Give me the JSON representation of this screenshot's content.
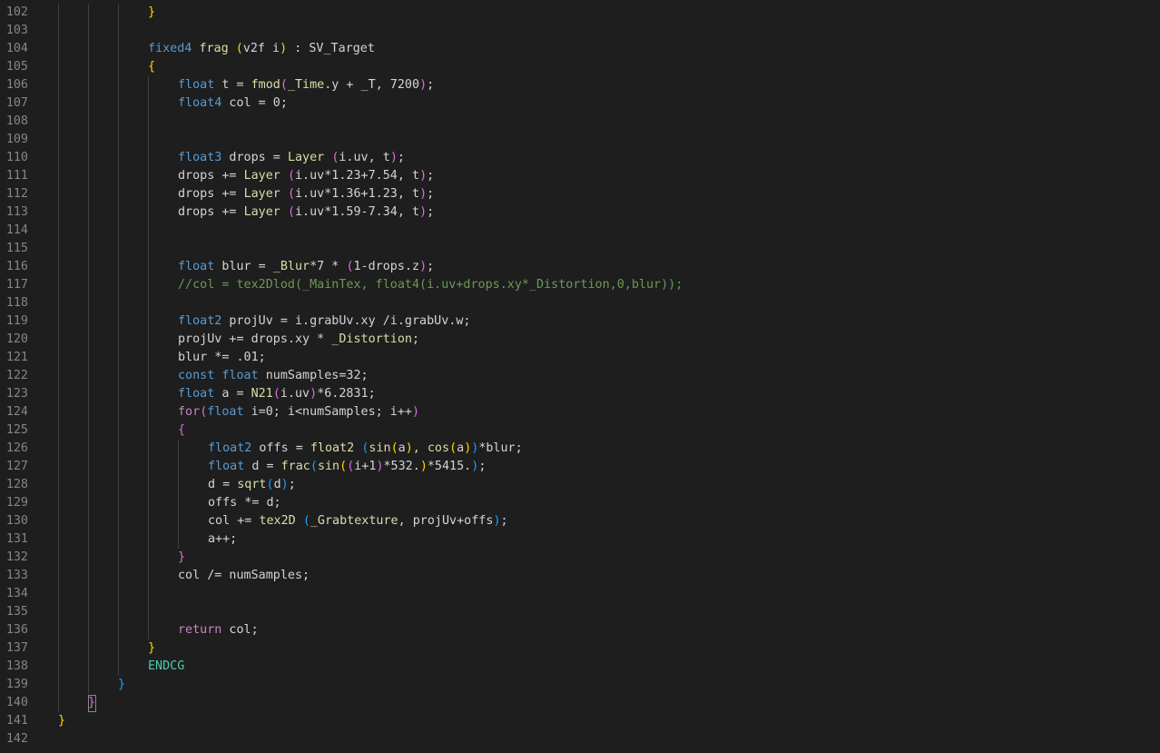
{
  "editor": {
    "language": "HLSL",
    "colors": {
      "background": "#1e1e1e",
      "line_number": "#858585",
      "keyword": "#569cd6",
      "type": "#4ec9b0",
      "function": "#dcdcaa",
      "variable": "#9cdcfe",
      "number": "#b5cea8",
      "comment": "#6a9955",
      "control": "#c586c0",
      "bracket_1": "#ffd700",
      "bracket_2": "#da70d6",
      "bracket_3": "#179fff",
      "text": "#d4d4d4"
    },
    "lines": [
      {
        "number": "102",
        "indent": 3,
        "tokens": [
          {
            "t": "}",
            "c": "b1"
          }
        ]
      },
      {
        "number": "103",
        "indent": 3,
        "tokens": []
      },
      {
        "number": "104",
        "indent": 3,
        "tokens": [
          {
            "t": "fixed4",
            "c": "kw"
          },
          {
            "t": " ",
            "c": "txt"
          },
          {
            "t": "frag",
            "c": "fn"
          },
          {
            "t": " ",
            "c": "txt"
          },
          {
            "t": "(",
            "c": "b1"
          },
          {
            "t": "v2f i",
            "c": "txt"
          },
          {
            "t": ")",
            "c": "b1"
          },
          {
            "t": " : SV_Target",
            "c": "txt"
          }
        ]
      },
      {
        "number": "105",
        "indent": 3,
        "tokens": [
          {
            "t": "{",
            "c": "b1"
          }
        ]
      },
      {
        "number": "106",
        "indent": 4,
        "tokens": [
          {
            "t": "float",
            "c": "kw"
          },
          {
            "t": " t = ",
            "c": "txt"
          },
          {
            "t": "fmod",
            "c": "fn"
          },
          {
            "t": "(",
            "c": "b2"
          },
          {
            "t": "_Time",
            "c": "fn"
          },
          {
            "t": ".y + ",
            "c": "txt"
          },
          {
            "t": "_T",
            "c": "fn"
          },
          {
            "t": ", 7200",
            "c": "txt"
          },
          {
            "t": ")",
            "c": "b2"
          },
          {
            "t": ";",
            "c": "txt"
          }
        ]
      },
      {
        "number": "107",
        "indent": 4,
        "tokens": [
          {
            "t": "float4",
            "c": "kw"
          },
          {
            "t": " col = 0;",
            "c": "txt"
          }
        ]
      },
      {
        "number": "108",
        "indent": 4,
        "tokens": []
      },
      {
        "number": "109",
        "indent": 4,
        "tokens": []
      },
      {
        "number": "110",
        "indent": 4,
        "tokens": [
          {
            "t": "float3",
            "c": "kw"
          },
          {
            "t": " drops = ",
            "c": "txt"
          },
          {
            "t": "Layer",
            "c": "fn"
          },
          {
            "t": " ",
            "c": "txt"
          },
          {
            "t": "(",
            "c": "b2"
          },
          {
            "t": "i.uv, t",
            "c": "txt"
          },
          {
            "t": ")",
            "c": "b2"
          },
          {
            "t": ";",
            "c": "txt"
          }
        ]
      },
      {
        "number": "111",
        "indent": 4,
        "tokens": [
          {
            "t": "drops += ",
            "c": "txt"
          },
          {
            "t": "Layer",
            "c": "fn"
          },
          {
            "t": " ",
            "c": "txt"
          },
          {
            "t": "(",
            "c": "b2"
          },
          {
            "t": "i.uv*1.23+7.54, t",
            "c": "txt"
          },
          {
            "t": ")",
            "c": "b2"
          },
          {
            "t": ";",
            "c": "txt"
          }
        ]
      },
      {
        "number": "112",
        "indent": 4,
        "tokens": [
          {
            "t": "drops += ",
            "c": "txt"
          },
          {
            "t": "Layer",
            "c": "fn"
          },
          {
            "t": " ",
            "c": "txt"
          },
          {
            "t": "(",
            "c": "b2"
          },
          {
            "t": "i.uv*1.36+1.23, t",
            "c": "txt"
          },
          {
            "t": ")",
            "c": "b2"
          },
          {
            "t": ";",
            "c": "txt"
          }
        ]
      },
      {
        "number": "113",
        "indent": 4,
        "tokens": [
          {
            "t": "drops += ",
            "c": "txt"
          },
          {
            "t": "Layer",
            "c": "fn"
          },
          {
            "t": " ",
            "c": "txt"
          },
          {
            "t": "(",
            "c": "b2"
          },
          {
            "t": "i.uv*1.59-7.34, t",
            "c": "txt"
          },
          {
            "t": ")",
            "c": "b2"
          },
          {
            "t": ";",
            "c": "txt"
          }
        ]
      },
      {
        "number": "114",
        "indent": 4,
        "tokens": []
      },
      {
        "number": "115",
        "indent": 4,
        "tokens": []
      },
      {
        "number": "116",
        "indent": 4,
        "tokens": [
          {
            "t": "float",
            "c": "kw"
          },
          {
            "t": " blur = ",
            "c": "txt"
          },
          {
            "t": "_Blur",
            "c": "fn"
          },
          {
            "t": "*7 * ",
            "c": "txt"
          },
          {
            "t": "(",
            "c": "b2"
          },
          {
            "t": "1-drops.z",
            "c": "txt"
          },
          {
            "t": ")",
            "c": "b2"
          },
          {
            "t": ";",
            "c": "txt"
          }
        ]
      },
      {
        "number": "117",
        "indent": 4,
        "tokens": [
          {
            "t": "//col = tex2Dlod(_MainTex, float4(i.uv+drops.xy*_Distortion,0,blur));",
            "c": "cm"
          }
        ]
      },
      {
        "number": "118",
        "indent": 4,
        "tokens": []
      },
      {
        "number": "119",
        "indent": 4,
        "tokens": [
          {
            "t": "float2",
            "c": "kw"
          },
          {
            "t": " projUv = i.grabUv.xy /i.grabUv.w;",
            "c": "txt"
          }
        ]
      },
      {
        "number": "120",
        "indent": 4,
        "tokens": [
          {
            "t": "projUv += drops.xy * ",
            "c": "txt"
          },
          {
            "t": "_Distortion",
            "c": "fn"
          },
          {
            "t": ";",
            "c": "txt"
          }
        ]
      },
      {
        "number": "121",
        "indent": 4,
        "tokens": [
          {
            "t": "blur *= .01;",
            "c": "txt"
          }
        ]
      },
      {
        "number": "122",
        "indent": 4,
        "tokens": [
          {
            "t": "const",
            "c": "kw"
          },
          {
            "t": " ",
            "c": "txt"
          },
          {
            "t": "float",
            "c": "kw"
          },
          {
            "t": " numSamples=32;",
            "c": "txt"
          }
        ]
      },
      {
        "number": "123",
        "indent": 4,
        "tokens": [
          {
            "t": "float",
            "c": "kw"
          },
          {
            "t": " a = ",
            "c": "txt"
          },
          {
            "t": "N21",
            "c": "fn"
          },
          {
            "t": "(",
            "c": "b2"
          },
          {
            "t": "i.uv",
            "c": "txt"
          },
          {
            "t": ")",
            "c": "b2"
          },
          {
            "t": "*6.2831;",
            "c": "txt"
          }
        ]
      },
      {
        "number": "124",
        "indent": 4,
        "tokens": [
          {
            "t": "for",
            "c": "ctl"
          },
          {
            "t": "(",
            "c": "b2"
          },
          {
            "t": "float",
            "c": "kw"
          },
          {
            "t": " i=0; i<numSamples; i++",
            "c": "txt"
          },
          {
            "t": ")",
            "c": "b2"
          }
        ]
      },
      {
        "number": "125",
        "indent": 4,
        "tokens": [
          {
            "t": "{",
            "c": "b2"
          }
        ]
      },
      {
        "number": "126",
        "indent": 5,
        "tokens": [
          {
            "t": "float2",
            "c": "kw"
          },
          {
            "t": " offs = ",
            "c": "txt"
          },
          {
            "t": "float2",
            "c": "fn"
          },
          {
            "t": " ",
            "c": "txt"
          },
          {
            "t": "(",
            "c": "b3"
          },
          {
            "t": "sin",
            "c": "fn"
          },
          {
            "t": "(",
            "c": "b1"
          },
          {
            "t": "a",
            "c": "txt"
          },
          {
            "t": ")",
            "c": "b1"
          },
          {
            "t": ", ",
            "c": "txt"
          },
          {
            "t": "cos",
            "c": "fn"
          },
          {
            "t": "(",
            "c": "b1"
          },
          {
            "t": "a",
            "c": "txt"
          },
          {
            "t": ")",
            "c": "b1"
          },
          {
            "t": ")",
            "c": "b3"
          },
          {
            "t": "*blur;",
            "c": "txt"
          }
        ]
      },
      {
        "number": "127",
        "indent": 5,
        "tokens": [
          {
            "t": "float",
            "c": "kw"
          },
          {
            "t": " d = ",
            "c": "txt"
          },
          {
            "t": "frac",
            "c": "fn"
          },
          {
            "t": "(",
            "c": "b3"
          },
          {
            "t": "sin",
            "c": "fn"
          },
          {
            "t": "(",
            "c": "b1"
          },
          {
            "t": "(",
            "c": "b2"
          },
          {
            "t": "i+1",
            "c": "txt"
          },
          {
            "t": ")",
            "c": "b2"
          },
          {
            "t": "*532.",
            "c": "txt"
          },
          {
            "t": ")",
            "c": "b1"
          },
          {
            "t": "*5415.",
            "c": "txt"
          },
          {
            "t": ")",
            "c": "b3"
          },
          {
            "t": ";",
            "c": "txt"
          }
        ]
      },
      {
        "number": "128",
        "indent": 5,
        "tokens": [
          {
            "t": "d = ",
            "c": "txt"
          },
          {
            "t": "sqrt",
            "c": "fn"
          },
          {
            "t": "(",
            "c": "b3"
          },
          {
            "t": "d",
            "c": "txt"
          },
          {
            "t": ")",
            "c": "b3"
          },
          {
            "t": ";",
            "c": "txt"
          }
        ]
      },
      {
        "number": "129",
        "indent": 5,
        "tokens": [
          {
            "t": "offs *= d;",
            "c": "txt"
          }
        ]
      },
      {
        "number": "130",
        "indent": 5,
        "tokens": [
          {
            "t": "col += ",
            "c": "txt"
          },
          {
            "t": "tex2D",
            "c": "fn"
          },
          {
            "t": " ",
            "c": "txt"
          },
          {
            "t": "(",
            "c": "b3"
          },
          {
            "t": "_Grabtexture",
            "c": "fn"
          },
          {
            "t": ", projUv+offs",
            "c": "txt"
          },
          {
            "t": ")",
            "c": "b3"
          },
          {
            "t": ";",
            "c": "txt"
          }
        ]
      },
      {
        "number": "131",
        "indent": 5,
        "tokens": [
          {
            "t": "a++;",
            "c": "txt"
          }
        ]
      },
      {
        "number": "132",
        "indent": 4,
        "tokens": [
          {
            "t": "}",
            "c": "b2"
          }
        ]
      },
      {
        "number": "133",
        "indent": 4,
        "tokens": [
          {
            "t": "col /= numSamples;",
            "c": "txt"
          }
        ]
      },
      {
        "number": "134",
        "indent": 4,
        "tokens": []
      },
      {
        "number": "135",
        "indent": 4,
        "tokens": []
      },
      {
        "number": "136",
        "indent": 4,
        "tokens": [
          {
            "t": "return",
            "c": "ctl"
          },
          {
            "t": " col;",
            "c": "txt"
          }
        ]
      },
      {
        "number": "137",
        "indent": 3,
        "tokens": [
          {
            "t": "}",
            "c": "b1"
          }
        ]
      },
      {
        "number": "138",
        "indent": 3,
        "tokens": [
          {
            "t": "ENDCG",
            "c": "ty"
          }
        ]
      },
      {
        "number": "139",
        "indent": 2,
        "tokens": [
          {
            "t": "}",
            "c": "b3"
          }
        ]
      },
      {
        "number": "140",
        "indent": 1,
        "tokens": [
          {
            "t": "}",
            "c": "b2"
          }
        ]
      },
      {
        "number": "141",
        "indent": 0,
        "tokens": [
          {
            "t": "}",
            "c": "b1"
          }
        ]
      },
      {
        "number": "142",
        "indent": 0,
        "tokens": []
      }
    ]
  }
}
